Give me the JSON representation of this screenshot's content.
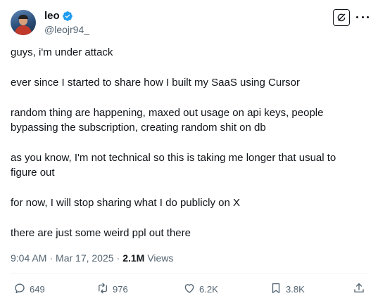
{
  "author": {
    "display_name": "leo",
    "handle": "@leojr94_",
    "verified_icon": "verified-badge-icon",
    "verified_color": "#1d9bf0"
  },
  "header_icons": {
    "grok": "grok-icon",
    "more": "more-icon"
  },
  "post": {
    "paragraphs": [
      "guys, i'm under attack",
      "ever since I started to share how I built my SaaS using Cursor",
      "random thing are happening, maxed out usage on api keys, people bypassing the subscription, creating random shit on db",
      "as you know, I'm not technical so this is taking me longer that usual to figure out",
      "for now, I will stop sharing what I do publicly on X",
      "there are just some weird ppl out there"
    ]
  },
  "meta": {
    "time": "9:04 AM",
    "separator": "·",
    "date": "Mar 17, 2025",
    "views_count": "2.1M",
    "views_label": "Views"
  },
  "actions": {
    "replies": "649",
    "reposts": "976",
    "likes": "6.2K",
    "bookmarks": "3.8K"
  },
  "colors": {
    "text_primary": "#0f1419",
    "text_secondary": "#536471",
    "divider": "#eff3f4"
  }
}
